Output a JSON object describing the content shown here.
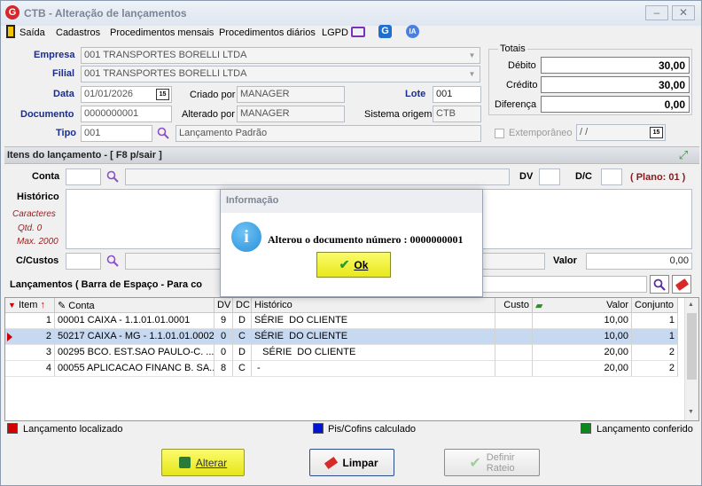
{
  "window": {
    "title": "CTB - Alteração de lançamentos",
    "logo": "G"
  },
  "menu": [
    "Saída",
    "Cadastros",
    "Procedimentos mensais",
    "Procedimentos diários",
    "LGPD"
  ],
  "header": {
    "empresa_label": "Empresa",
    "empresa_value": "001 TRANSPORTES BORELLI LTDA",
    "filial_label": "Filial",
    "filial_value": "001 TRANSPORTES BORELLI LTDA",
    "data_label": "Data",
    "data_value": "01/01/2026",
    "criado_label": "Criado por",
    "criado_value": "MANAGER",
    "lote_label": "Lote",
    "lote_value": "001",
    "documento_label": "Documento",
    "documento_value": "0000000001",
    "alterado_label": "Alterado por",
    "alterado_value": "MANAGER",
    "sistema_label": "Sistema origem",
    "sistema_value": "CTB",
    "tipo_label": "Tipo",
    "tipo_value": "001",
    "tipo_desc": "Lançamento Padrão",
    "extemporaneo_label": "Extemporâneo",
    "extemporaneo_value": " / /"
  },
  "totais": {
    "title": "Totais",
    "debito_label": "Débito",
    "debito_value": "30,00",
    "credito_label": "Crédito",
    "credito_value": "30,00",
    "diferenca_label": "Diferença",
    "diferenca_value": "0,00"
  },
  "items": {
    "section_title": "Itens do lançamento - [ F8 p/sair ]",
    "conta_label": "Conta",
    "dv_label": "DV",
    "dc_label": "D/C",
    "plano_label": "( Plano: 01 )",
    "historico_label": "Histórico",
    "caracteres_label": "Caracteres",
    "qtd_label": "Qtd. 0",
    "max_label": "Max. 2000",
    "ccustos_label": "C/Custos",
    "valor_label": "Valor",
    "valor_value": "0,00",
    "lancamentos_label": "Lançamentos ( Barra de Espaço - Para co"
  },
  "grid": {
    "columns": [
      "Item",
      "Conta",
      "DV",
      "DC",
      "Histórico",
      "Custo",
      "Valor",
      "Conjunto"
    ],
    "rows": [
      {
        "item": "1",
        "conta": "00001 CAIXA - 1.1.01.01.0001",
        "dv": "9",
        "dc": "D",
        "historico": "SÉRIE  DO CLIENTE",
        "custo": "",
        "valor": "10,00",
        "conjunto": "1"
      },
      {
        "item": "2",
        "conta": "50217 CAIXA - MG - 1.1.01.01.0002",
        "dv": "0",
        "dc": "C",
        "historico": "SÉRIE  DO CLIENTE",
        "custo": "",
        "valor": "10,00",
        "conjunto": "1"
      },
      {
        "item": "3",
        "conta": "00295 BCO. EST.SAO PAULO-C. ...",
        "dv": "0",
        "dc": "D",
        "historico": "   SÉRIE  DO CLIENTE",
        "custo": "",
        "valor": "20,00",
        "conjunto": "2"
      },
      {
        "item": "4",
        "conta": "00055 APLICACAO FINANC B. SA...",
        "dv": "8",
        "dc": "C",
        "historico": " -",
        "custo": "",
        "valor": "20,00",
        "conjunto": "2"
      }
    ]
  },
  "legend": {
    "localizado": "Lançamento localizado",
    "localizado_color": "#d40000",
    "piscofins": "Pis/Cofins calculado",
    "piscofins_color": "#0016d4",
    "conferido": "Lançamento conferido",
    "conferido_color": "#0a8a1a"
  },
  "buttons": {
    "alterar": "Alterar",
    "limpar": "Limpar",
    "definir_rateio_1": "Definir",
    "definir_rateio_2": "Rateio"
  },
  "dialog": {
    "title": "Informação",
    "message": "Alterou o documento número : 0000000001",
    "ok": "Ok"
  }
}
